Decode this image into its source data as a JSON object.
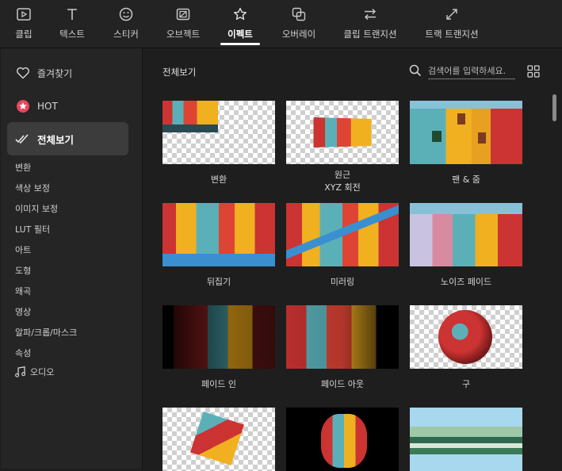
{
  "tabs": [
    {
      "label": "클립",
      "icon": "play-icon"
    },
    {
      "label": "텍스트",
      "icon": "text-icon"
    },
    {
      "label": "스티커",
      "icon": "sticker-icon"
    },
    {
      "label": "오브젝트",
      "icon": "object-icon"
    },
    {
      "label": "이펙트",
      "icon": "effect-icon",
      "active": true
    },
    {
      "label": "오버레이",
      "icon": "overlay-icon"
    },
    {
      "label": "클립 트랜지션",
      "icon": "clip-transition-icon"
    },
    {
      "label": "트랙 트랜지션",
      "icon": "track-transition-icon"
    }
  ],
  "sidebar": {
    "main": [
      {
        "label": "즐겨찾기",
        "icon": "heart-icon"
      },
      {
        "label": "HOT",
        "icon": "hot-icon"
      },
      {
        "label": "전체보기",
        "icon": "check-all-icon",
        "active": true
      }
    ],
    "categories": [
      "변환",
      "색상 보정",
      "이미지 보정",
      "LUT 필터",
      "아트",
      "도형",
      "왜곡",
      "영상",
      "알파/크롭/마스크",
      "속성"
    ],
    "audio": {
      "label": "오디오",
      "icon": "music-note-icon"
    }
  },
  "main": {
    "breadcrumb": "전체보기",
    "search_placeholder": "검색어를 입력하세요.",
    "items": [
      {
        "label": "변환"
      },
      {
        "label": "원근\nXYZ 회전"
      },
      {
        "label": "팬 & 줌"
      },
      {
        "label": "뒤집기"
      },
      {
        "label": "미러링"
      },
      {
        "label": "노이즈 페이드"
      },
      {
        "label": "페이드 인"
      },
      {
        "label": "페이드 아웃"
      },
      {
        "label": "구"
      },
      {
        "label": ""
      },
      {
        "label": ""
      },
      {
        "label": ""
      }
    ]
  },
  "colors": {
    "accent": "#e8465a",
    "bg": "#1e1e1e",
    "panel": "#252525",
    "active": "#3c3c3c"
  }
}
